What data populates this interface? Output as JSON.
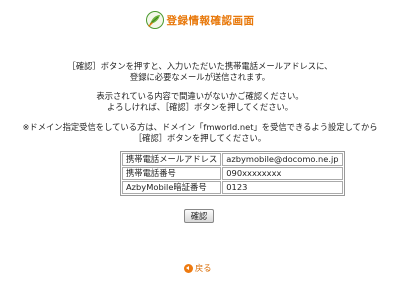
{
  "header": {
    "title": "登録情報確認画面"
  },
  "instructions": {
    "p1": [
      "［確認］ボタンを押すと、入力いただいた携帯電話メールアドレスに、",
      "登録に必要なメールが送信されます。"
    ],
    "p2": [
      "表示されている内容で間違いがないかご確認ください。",
      "よろしければ、［確認］ボタンを押してください。"
    ],
    "p3": [
      "※ドメイン指定受信をしている方は、ドメイン「fmworld.net」を受信できるよう設定してから",
      "［確認］ボタンを押してください。"
    ]
  },
  "info_table": {
    "rows": [
      {
        "label": "携帯電話メールアドレス",
        "value": "azbymobile@docomo.ne.jp"
      },
      {
        "label": "携帯電話番号",
        "value": "090xxxxxxxx"
      },
      {
        "label": "AzbyMobile暗証番号",
        "value": "0123"
      }
    ]
  },
  "actions": {
    "confirm_label": "確認",
    "back_label": "戻る"
  },
  "colors": {
    "title": "#e8780a",
    "back_link": "#d96a00",
    "logo_green": "#4a9a2e"
  },
  "icons": {
    "logo": "pen-leaf-logo-icon",
    "back": "back-arrow-icon"
  }
}
